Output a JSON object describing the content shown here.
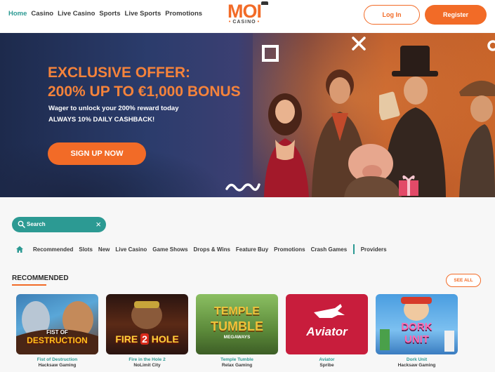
{
  "header": {
    "nav": [
      "Home",
      "Casino",
      "Live Casino",
      "Sports",
      "Live Sports",
      "Promotions"
    ],
    "logo": {
      "main": "MOI",
      "sub": "CASINO"
    },
    "login_label": "Log In",
    "register_label": "Register"
  },
  "hero": {
    "title_line1": "EXCLUSIVE OFFER:",
    "title_line2": "200% UP TO €1,000 BONUS",
    "line1": "Wager to unlock your 200% reward today",
    "line2": "ALWAYS 10% DAILY CASHBACK!",
    "cta_label": "SIGN UP NOW"
  },
  "search": {
    "placeholder": "Search"
  },
  "categories": [
    "Recommended",
    "Slots",
    "New",
    "Live Casino",
    "Game Shows",
    "Drops & Wins",
    "Feature Buy",
    "Promotions",
    "Crash Games"
  ],
  "providers_label": "Providers",
  "recommended": {
    "title": "RECOMMENDED",
    "see_all_label": "SEE ALL",
    "games": [
      {
        "title": "Fist of Destruction",
        "provider": "Hacksaw Gaming",
        "art": [
          "FIST OF",
          "DESTRUCTION"
        ]
      },
      {
        "title": "Fire in the Hole 2",
        "provider": "NoLimit City",
        "art": [
          "FIRE",
          "2",
          "HOLE"
        ]
      },
      {
        "title": "Temple Tumble",
        "provider": "Relax Gaming",
        "art": [
          "TEMPLE",
          "TUMBLE",
          "MEGAWAYS"
        ]
      },
      {
        "title": "Aviator",
        "provider": "Spribe",
        "art": [
          "Aviator"
        ]
      },
      {
        "title": "Dork Unit",
        "provider": "Hacksaw Gaming",
        "art": [
          "DORK",
          "UNIT"
        ]
      }
    ]
  },
  "colors": {
    "accent": "#f26b27",
    "teal": "#2c9a93",
    "text": "#3b3b3b"
  }
}
